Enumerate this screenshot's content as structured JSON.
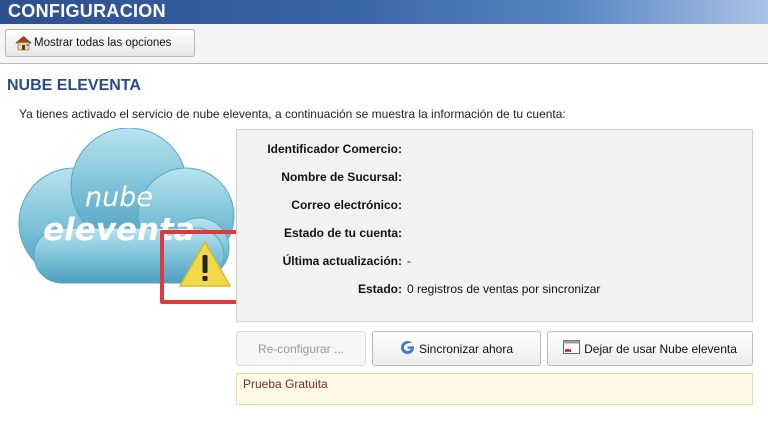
{
  "window": {
    "title": "CONFIGURACION"
  },
  "toolbar": {
    "show_all_label": "Mostrar todas las opciones",
    "show_all_icon": "home-icon"
  },
  "section": {
    "title": "NUBE ELEVENTA",
    "intro": "Ya tienes activado el servicio de nube eleventa, a continuación se muestra la información de tu cuenta:"
  },
  "logo": {
    "line1": "nube",
    "line2": "eleventa",
    "warning_icon": "warning-icon"
  },
  "info": {
    "rows": [
      {
        "label": "Identificador Comercio:",
        "value": ""
      },
      {
        "label": "Nombre de Sucursal:",
        "value": ""
      },
      {
        "label": "Correo electrónico:",
        "value": ""
      },
      {
        "label": "Estado de tu cuenta:",
        "value": ""
      },
      {
        "label": "Última actualización:",
        "value": "-"
      },
      {
        "label": "Estado:",
        "value": "0 registros de ventas por sincronizar"
      }
    ]
  },
  "actions": {
    "reconfigure_label": "Re-configurar ...",
    "sync_label": "Sincronizar ahora",
    "sync_icon": "g-sync-icon",
    "stop_label": "Dejar de usar Nube eleventa",
    "stop_icon": "window-icon"
  },
  "plan": {
    "label": "Prueba Gratuita"
  },
  "colors": {
    "title_bar": "#2c4f8f",
    "section_title": "#2a4c86",
    "warning_border": "#e0393c",
    "warning_fill": "#f2d84a",
    "cloud": "#7ec3d9"
  }
}
